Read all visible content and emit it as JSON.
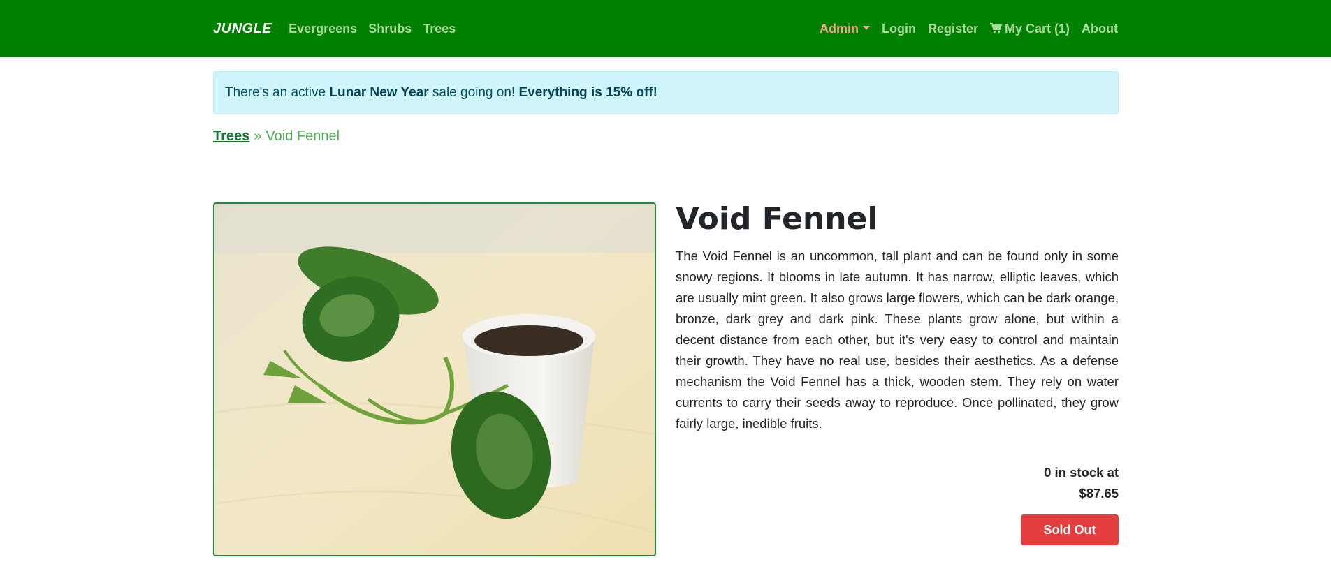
{
  "nav": {
    "brand": "JUNGLE",
    "left_links": [
      "Evergreens",
      "Shrubs",
      "Trees"
    ],
    "admin": "Admin",
    "login": "Login",
    "register": "Register",
    "cart_icon": "shopping-cart-icon",
    "cart": "My Cart (1)",
    "about": "About"
  },
  "alert": {
    "prefix": "There's an active ",
    "sale_name": "Lunar New Year",
    "middle": " sale going on! ",
    "discount": "Everything is 15% off!"
  },
  "breadcrumb": {
    "category": "Trees",
    "separator": "»",
    "current": "Void Fennel"
  },
  "product": {
    "name": "Void Fennel",
    "description": "The Void Fennel is an uncommon, tall plant and can be found only in some snowy regions. It blooms in late autumn. It has narrow, elliptic leaves, which are usually mint green. It also grows large flowers, which can be dark orange, bronze, dark grey and dark pink. These plants grow alone, but within a decent distance from each other, but it's very easy to control and maintain their growth. They have no real use, besides their aesthetics. As a defense mechanism the Void Fennel has a thick, wooden stem. They rely on water currents to carry their seeds away to reproduce. Once pollinated, they grow fairly large, inedible fruits.",
    "stock_line": "0 in stock at",
    "price": "$87.65",
    "button": "Sold Out"
  },
  "colors": {
    "navbar": "#008000",
    "accent": "#1f8c3a",
    "sold_out": "#e53e3e",
    "alert_bg": "#cff4fc"
  }
}
